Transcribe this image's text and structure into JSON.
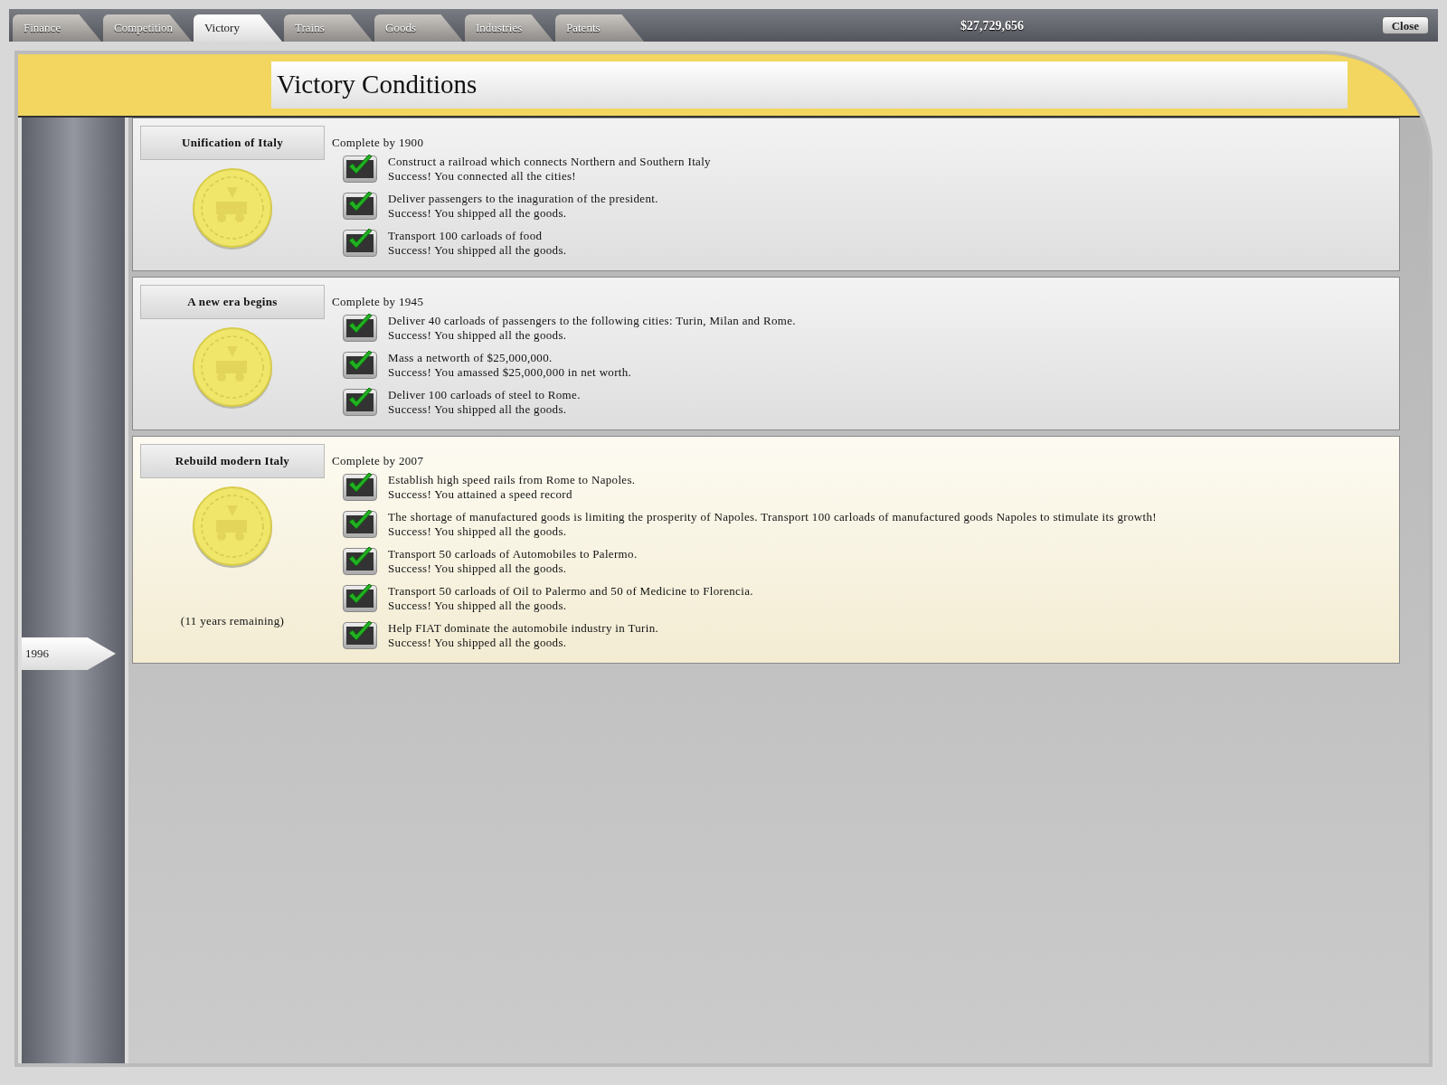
{
  "tabs": [
    {
      "label": "Finance",
      "selected": false
    },
    {
      "label": "Competition",
      "selected": false
    },
    {
      "label": "Victory",
      "selected": true
    },
    {
      "label": "Trains",
      "selected": false
    },
    {
      "label": "Goods",
      "selected": false
    },
    {
      "label": "Industries",
      "selected": false
    },
    {
      "label": "Patents",
      "selected": false
    }
  ],
  "money": "$27,729,656",
  "close_button": "Close",
  "title": "Victory Conditions",
  "timeline": {
    "year": "1996"
  },
  "sections": [
    {
      "title": "Unification of Italy",
      "deadline": "Complete by 1900",
      "current": false,
      "conditions": [
        {
          "task": "Construct a railroad which connects Northern and Southern Italy",
          "result": "Success! You connected all the cities!",
          "checked": true
        },
        {
          "task": "Deliver passengers to the inaguration of the president.",
          "result": "Success! You shipped all the goods.",
          "checked": true
        },
        {
          "task": "Transport 100 carloads of food",
          "result": "Success! You shipped all the goods.",
          "checked": true
        }
      ]
    },
    {
      "title": "A new era begins",
      "deadline": "Complete by 1945",
      "current": false,
      "conditions": [
        {
          "task": "Deliver 40 carloads of passengers to the following cities: Turin, Milan and Rome.",
          "result": "Success! You shipped all the goods.",
          "checked": true
        },
        {
          "task": "Mass a networth of $25,000,000.",
          "result": "Success! You amassed $25,000,000 in net worth.",
          "checked": true
        },
        {
          "task": "Deliver 100 carloads of steel to Rome.",
          "result": "Success! You shipped all the goods.",
          "checked": true
        }
      ]
    },
    {
      "title": "Rebuild modern Italy",
      "deadline": "Complete by 2007",
      "current": true,
      "remaining": "(11 years remaining)",
      "conditions": [
        {
          "task": "Establish high speed rails from Rome to Napoles.",
          "result": "Success! You attained a speed record",
          "checked": true
        },
        {
          "task": "The shortage of manufactured goods is limiting the prosperity of Napoles. Transport 100 carloads of manufactured goods Napoles to stimulate its growth!",
          "result": "Success! You shipped all the goods.",
          "checked": true
        },
        {
          "task": "Transport 50 carloads of Automobiles to Palermo.",
          "result": "Success! You shipped all the goods.",
          "checked": true
        },
        {
          "task": "Transport 50 carloads of Oil to Palermo and 50 of Medicine to Florencia.",
          "result": "Success! You shipped all the goods.",
          "checked": true
        },
        {
          "task": "Help FIAT dominate the automobile industry in Turin.",
          "result": "Success! You shipped all the goods.",
          "checked": true
        }
      ]
    }
  ]
}
